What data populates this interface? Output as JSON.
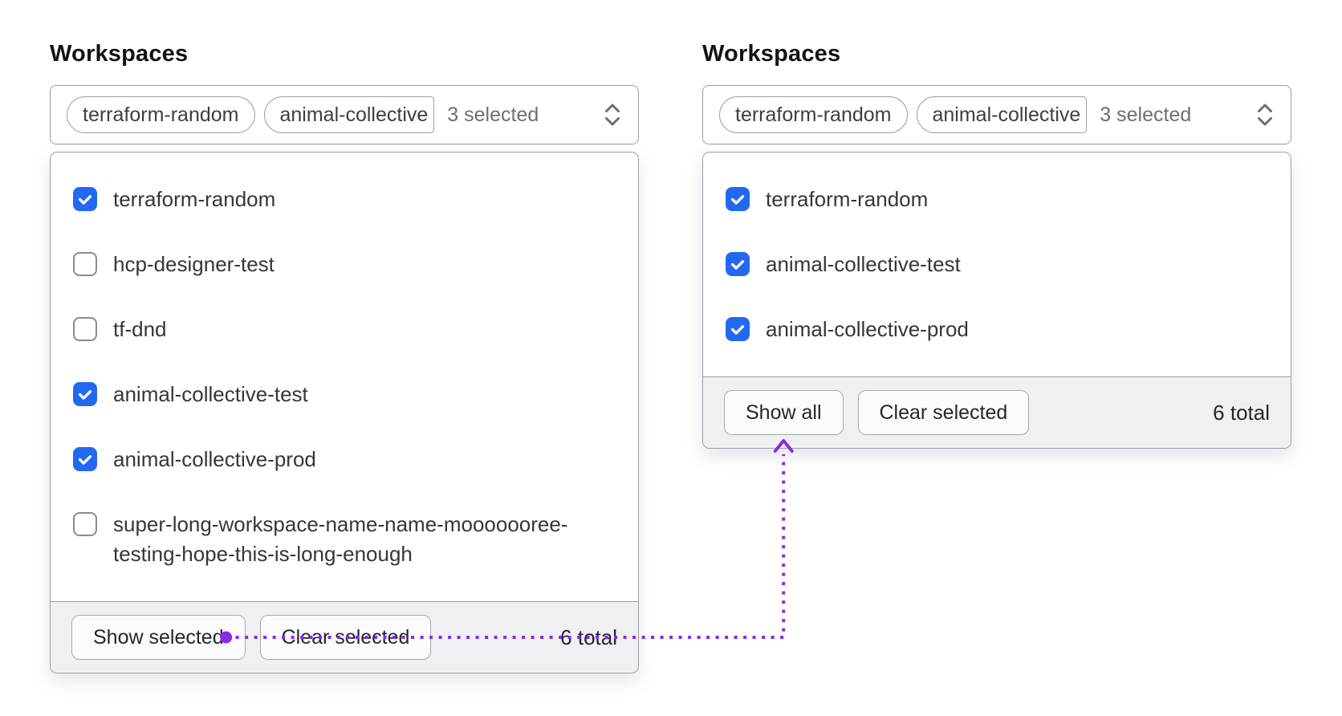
{
  "colors": {
    "checkbox_blue": "#2368f1",
    "connector_purple": "#8a2be2",
    "border_gray": "#99a0a8",
    "footer_bg": "#f0f0f2"
  },
  "panels": [
    {
      "label": "Workspaces",
      "trigger": {
        "tags": [
          "terraform-random",
          "animal-collective"
        ],
        "summary": "3 selected"
      },
      "options": [
        {
          "label": "terraform-random",
          "checked": true
        },
        {
          "label": "hcp-designer-test",
          "checked": false
        },
        {
          "label": "tf-dnd",
          "checked": false
        },
        {
          "label": "animal-collective-test",
          "checked": true
        },
        {
          "label": "animal-collective-prod",
          "checked": true
        },
        {
          "label": "super-long-workspace-name-name-mooooooree-testing-hope-this-is-long-enough",
          "checked": false
        }
      ],
      "footer": {
        "buttons": [
          "Show selected",
          "Clear selected"
        ],
        "total": "6 total"
      }
    },
    {
      "label": "Workspaces",
      "trigger": {
        "tags": [
          "terraform-random",
          "animal-collective"
        ],
        "summary": "3 selected"
      },
      "options": [
        {
          "label": "terraform-random",
          "checked": true
        },
        {
          "label": "animal-collective-test",
          "checked": true
        },
        {
          "label": "animal-collective-prod",
          "checked": true
        }
      ],
      "footer": {
        "buttons": [
          "Show all",
          "Clear selected"
        ],
        "total": "6 total"
      }
    }
  ]
}
